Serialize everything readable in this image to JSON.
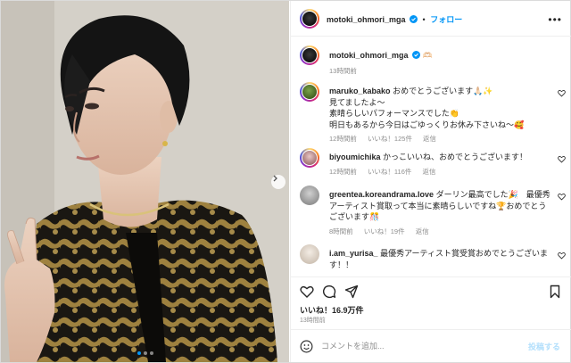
{
  "post": {
    "username": "motoki_ohmori_mga",
    "follow_label": "フォロー",
    "dot_separator": "•",
    "more_icon": "more-horizontal-icon",
    "caption_username": "motoki_ohmori_mga",
    "caption_emoji": "🫶🏻",
    "caption_time": "13時間前"
  },
  "comments": [
    {
      "username": "maruko_kabako",
      "text_lines": [
        "おめでとうございます🙏🏻✨",
        "見てましたよ〜",
        "素晴らしいパフォーマンスでした👏",
        "明日もあるから今日はごゆっくりお休み下さいね〜🥰"
      ],
      "time": "12時間前",
      "likes": "いいね！125件",
      "reply": "返信"
    },
    {
      "username": "biyoumichika",
      "text_lines": [
        "かっこいいね、おめでとうございます！"
      ],
      "time": "12時間前",
      "likes": "いいね！116件",
      "reply": "返信"
    },
    {
      "username": "greentea.koreandrama.love",
      "text_lines": [
        "ダーリン最高でした🎉　最優秀",
        "アーティスト賞取って本当に素晴らしいですね🏆おめでとう",
        "ございます🎊"
      ],
      "time": "8時間前",
      "likes": "いいね！19件",
      "reply": "返信"
    },
    {
      "username": "i.am_yurisa_",
      "text_lines": [
        "最優秀アーティスト賞受賞おめでとうございま",
        "す！！"
      ],
      "time": "",
      "likes": "",
      "reply": ""
    }
  ],
  "stats": {
    "likes": "いいね！16.9万件",
    "time": "13時間前"
  },
  "comment_box": {
    "placeholder": "コメントを追加...",
    "post_label": "投稿する"
  },
  "colors": {
    "accent": "#0095f6",
    "muted": "#8e8e8e",
    "post_disabled": "#b2dffc"
  }
}
